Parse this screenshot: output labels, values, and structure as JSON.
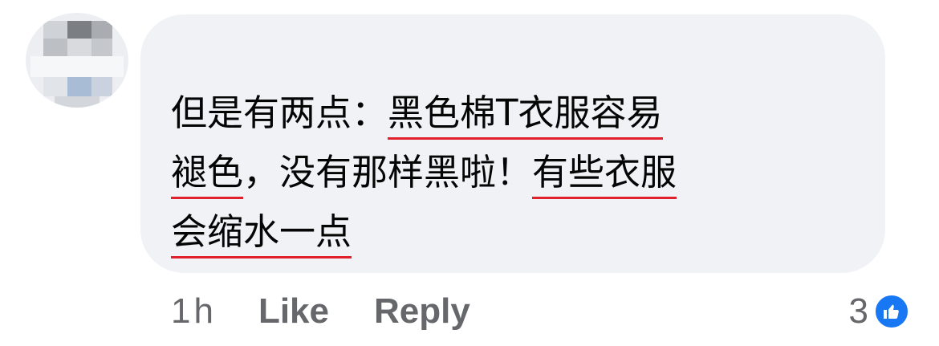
{
  "comment": {
    "author": "",
    "lines": [
      [
        {
          "text": "但是有两点：",
          "highlight": false
        },
        {
          "text": "黑色棉T衣服容易",
          "highlight": true
        }
      ],
      [
        {
          "text": "褪色",
          "highlight": true
        },
        {
          "text": "，没有那样黑啦！",
          "highlight": false
        },
        {
          "text": "有些衣服",
          "highlight": true
        }
      ],
      [
        {
          "text": "会缩水一点",
          "highlight": true
        }
      ]
    ],
    "highlight_color": "#e0202a"
  },
  "actions": {
    "time": "1h",
    "like_label": "Like",
    "reply_label": "Reply"
  },
  "reactions": {
    "count": "3",
    "icon": "thumbs-up-icon",
    "badge_color": "#1877f2"
  },
  "colors": {
    "bubble": "#f0f2f5",
    "text": "#050505",
    "meta": "#65676b"
  }
}
